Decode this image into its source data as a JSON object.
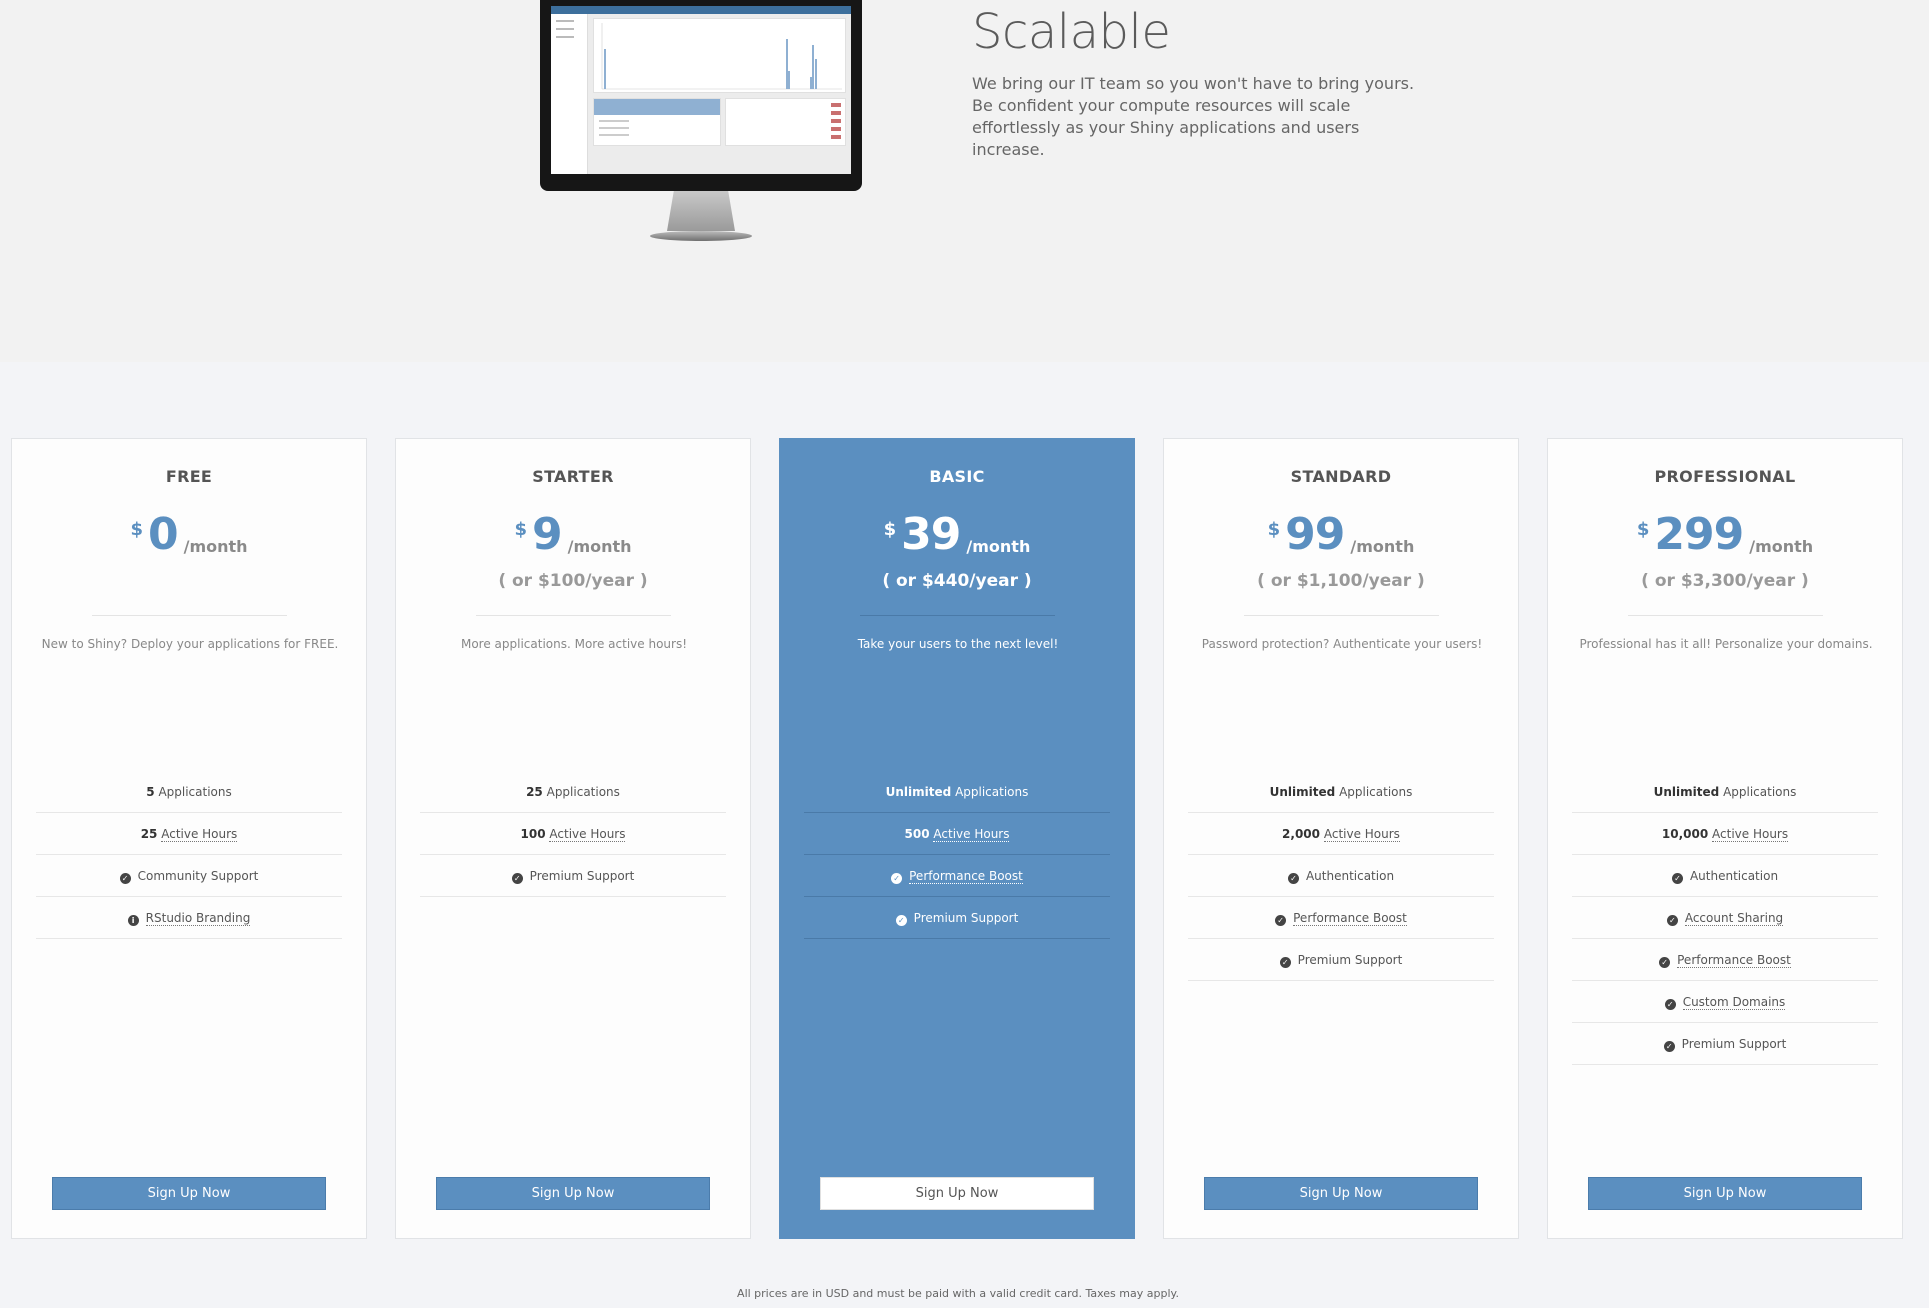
{
  "hero": {
    "title": "Scalable",
    "text": "We bring our IT team so you won't have to bring yours. Be confident your compute resources will scale effortlessly as your Shiny applications and users increase."
  },
  "plans": [
    {
      "name": "FREE",
      "currency": "$",
      "amount": "0",
      "period": "/month",
      "yearly": "",
      "tagline": "New to Shiny? Deploy your applications for FREE.",
      "features": [
        {
          "value": "5",
          "label": "Applications",
          "icon": ""
        },
        {
          "value": "25",
          "label": "Active Hours",
          "icon": ""
        },
        {
          "value": "",
          "label": "Community Support",
          "icon": "check-circle-icon"
        },
        {
          "value": "",
          "label": "RStudio Branding",
          "icon": "info-circle-icon"
        }
      ],
      "button": "Sign Up Now"
    },
    {
      "name": "STARTER",
      "currency": "$",
      "amount": "9",
      "period": "/month",
      "yearly": "( or $100/year )",
      "tagline": "More applications. More active hours!",
      "features": [
        {
          "value": "25",
          "label": "Applications",
          "icon": ""
        },
        {
          "value": "100",
          "label": "Active Hours",
          "icon": ""
        },
        {
          "value": "",
          "label": "Premium Support",
          "icon": "check-circle-icon"
        }
      ],
      "button": "Sign Up Now"
    },
    {
      "name": "BASIC",
      "currency": "$",
      "amount": "39",
      "period": "/month",
      "yearly": "( or $440/year )",
      "tagline": "Take your users to the next level!",
      "features": [
        {
          "value": "Unlimited",
          "label": "Applications",
          "icon": ""
        },
        {
          "value": "500",
          "label": "Active Hours",
          "icon": ""
        },
        {
          "value": "",
          "label": "Performance Boost",
          "icon": "check-circle-icon"
        },
        {
          "value": "",
          "label": "Premium Support",
          "icon": "check-circle-icon"
        }
      ],
      "button": "Sign Up Now"
    },
    {
      "name": "STANDARD",
      "currency": "$",
      "amount": "99",
      "period": "/month",
      "yearly": "( or $1,100/year )",
      "tagline": "Password protection? Authenticate your users!",
      "features": [
        {
          "value": "Unlimited",
          "label": "Applications",
          "icon": ""
        },
        {
          "value": "2,000",
          "label": "Active Hours",
          "icon": ""
        },
        {
          "value": "",
          "label": "Authentication",
          "icon": "check-circle-icon"
        },
        {
          "value": "",
          "label": "Performance Boost",
          "icon": "check-circle-icon"
        },
        {
          "value": "",
          "label": "Premium Support",
          "icon": "check-circle-icon"
        }
      ],
      "button": "Sign Up Now"
    },
    {
      "name": "PROFESSIONAL",
      "currency": "$",
      "amount": "299",
      "period": "/month",
      "yearly": "( or $3,300/year )",
      "tagline": "Professional has it all! Personalize your domains.",
      "features": [
        {
          "value": "Unlimited",
          "label": "Applications",
          "icon": ""
        },
        {
          "value": "10,000",
          "label": "Active Hours",
          "icon": ""
        },
        {
          "value": "",
          "label": "Authentication",
          "icon": "check-circle-icon"
        },
        {
          "value": "",
          "label": "Account Sharing",
          "icon": "check-circle-icon"
        },
        {
          "value": "",
          "label": "Performance Boost",
          "icon": "check-circle-icon"
        },
        {
          "value": "",
          "label": "Custom Domains",
          "icon": "check-circle-icon"
        },
        {
          "value": "",
          "label": "Premium Support",
          "icon": "check-circle-icon"
        }
      ],
      "button": "Sign Up Now"
    }
  ],
  "footnote": "All prices are in USD and must be paid with a valid credit card. Taxes may apply.",
  "colors": {
    "accent": "#5b8fc0",
    "background": "#f3f4f7",
    "card": "#fdfdfd"
  }
}
